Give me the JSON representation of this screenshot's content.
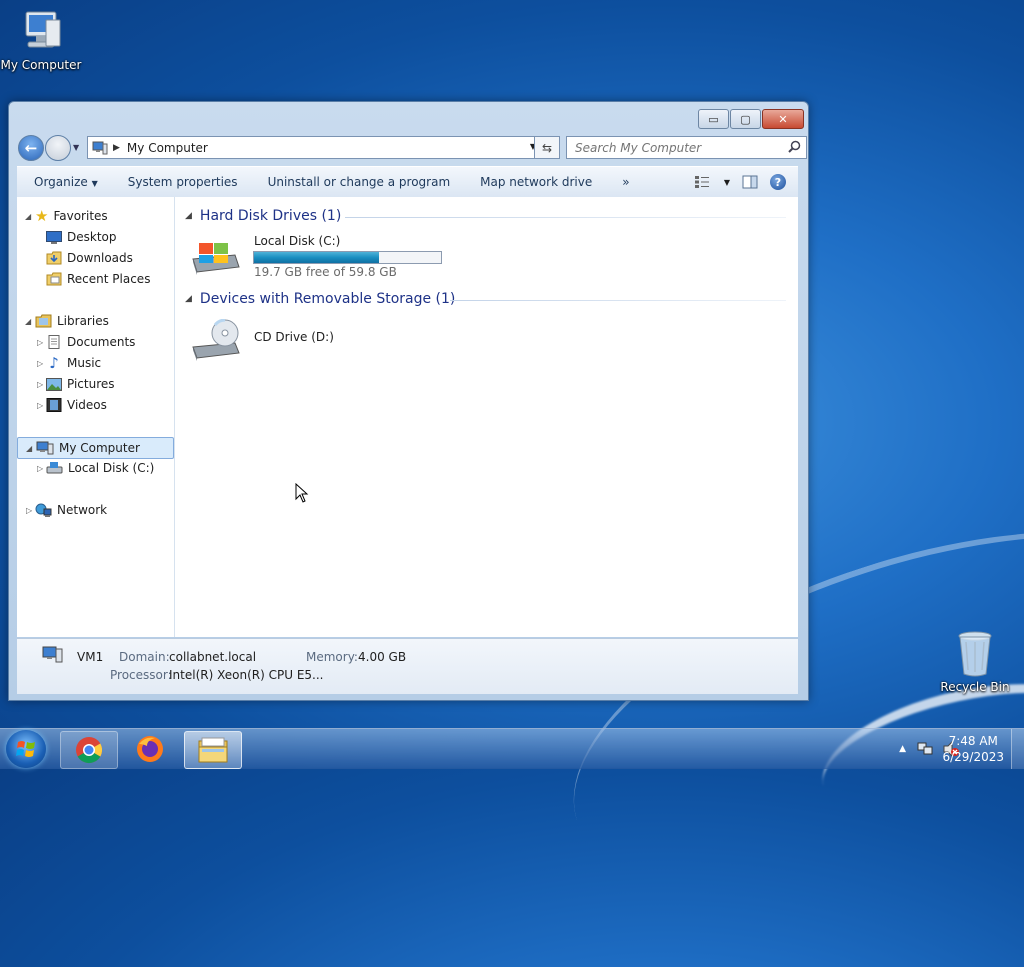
{
  "desktop": {
    "icons": [
      {
        "label": "My Computer"
      },
      {
        "label": "Recycle Bin"
      }
    ]
  },
  "window": {
    "controls": {
      "minimize": "▭",
      "maximize": "▢",
      "close": "✕"
    },
    "address": {
      "path": "My Computer"
    },
    "search": {
      "placeholder": "Search My Computer"
    },
    "toolbar": {
      "organize": "Organize",
      "system_properties": "System properties",
      "uninstall": "Uninstall or change a program",
      "map_drive": "Map network drive",
      "more": "»"
    },
    "nav": {
      "favorites": "Favorites",
      "desktop": "Desktop",
      "downloads": "Downloads",
      "recent": "Recent Places",
      "libraries": "Libraries",
      "documents": "Documents",
      "music": "Music",
      "pictures": "Pictures",
      "videos": "Videos",
      "my_computer": "My Computer",
      "local_disk": "Local Disk (C:)",
      "network": "Network"
    },
    "groups": {
      "hdd_header": "Hard Disk Drives (1)",
      "removable_header": "Devices with Removable Storage (1)"
    },
    "drives": {
      "c_name": "Local Disk (C:)",
      "c_free": "19.7 GB free of 59.8 GB",
      "c_used_fraction": 0.67,
      "d_name": "CD Drive (D:)"
    },
    "details": {
      "name": "VM1",
      "domain_label": "Domain:",
      "domain_value": "collabnet.local",
      "memory_label": "Memory:",
      "memory_value": "4.00 GB",
      "processor_label": "Processor:",
      "processor_value": "Intel(R) Xeon(R) CPU E5..."
    }
  },
  "taskbar": {
    "apps": [
      "chrome",
      "firefox",
      "explorer"
    ],
    "time": "7:48 AM",
    "date": "6/29/2023",
    "tray_arrow": "▲"
  }
}
